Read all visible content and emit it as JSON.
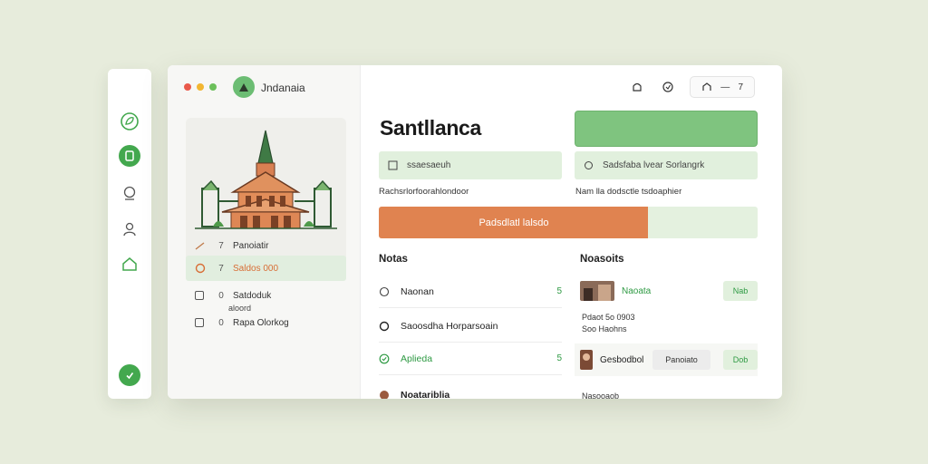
{
  "window": {
    "app_title": "Jndanaia"
  },
  "sidebar": {
    "rows": [
      {
        "num": "7",
        "label": "Panoiatir"
      },
      {
        "num": "7",
        "label": "Saldos 000"
      },
      {
        "num": "0",
        "label": "Satdoduk"
      },
      {
        "num": "0",
        "label": "Rapa Olorkog"
      }
    ],
    "sub_label": "aloord"
  },
  "toolbar": {
    "pill_label": "7"
  },
  "main": {
    "title": "Santllanca",
    "field_left": {
      "value": "ssaesaeuh"
    },
    "field_right": {
      "value": "Sadsfaba lvear Sorlangrk"
    },
    "caption_left": "Rachsrlorfoorahlondoor",
    "caption_right": "Nam lla dodsctle tsdoaphier",
    "progress": {
      "label": "Padsdlatl lalsdo",
      "percent": 71
    }
  },
  "notes": {
    "title": "Notas",
    "items": [
      {
        "label": "Naonan",
        "chev": "5"
      },
      {
        "label": "Saoosdha Horparsoain",
        "chev": ""
      },
      {
        "label": "Aplieda",
        "chev": "5"
      },
      {
        "label": "Noatariblia",
        "chev": ""
      }
    ]
  },
  "reports": {
    "title": "Noasoits",
    "items": [
      {
        "label": "Naoata",
        "button": "Nab"
      },
      {
        "label": "Gesbodbol",
        "button_secondary": "Panoiato",
        "button": "Dob"
      }
    ],
    "meta_1": "Pdaot 5o 0903",
    "meta_2": "Soo Haohns",
    "meta_3": "Nasooaob"
  },
  "colors": {
    "accent_green": "#43a84e",
    "accent_orange": "#e08350",
    "soft_green": "#e1f0dd"
  }
}
